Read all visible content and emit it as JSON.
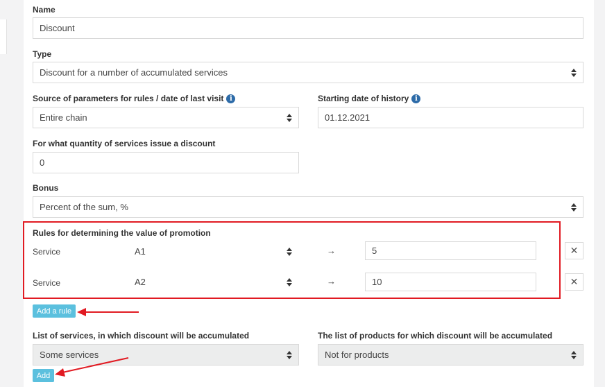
{
  "form": {
    "name": {
      "label": "Name",
      "value": "Discount"
    },
    "type": {
      "label": "Type",
      "value": "Discount for a number of accumulated services"
    },
    "source": {
      "label": "Source of parameters for rules / date of last visit",
      "value": "Entire chain"
    },
    "start_date": {
      "label": "Starting date of history",
      "value": "01.12.2021"
    },
    "quantity": {
      "label": "For what quantity of services issue a discount",
      "value": "0"
    },
    "bonus": {
      "label": "Bonus",
      "value": "Percent of the sum, %"
    },
    "rules": {
      "label": "Rules for determining the value of promotion",
      "items": [
        {
          "kind": "Service",
          "service": "A1",
          "arrow": "→",
          "value": "5",
          "remove": "✕"
        },
        {
          "kind": "Service",
          "service": "A2",
          "arrow": "→",
          "value": "10",
          "remove": "✕"
        }
      ],
      "add_label": "Add a rule"
    },
    "services_list": {
      "label": "List of services, in which discount will be accumulated",
      "value": "Some services",
      "add_label": "Add"
    },
    "products_list": {
      "label": "The list of products for which discount will be accumulated",
      "value": "Not for products"
    }
  },
  "colors": {
    "annotation": "#e11a22",
    "button": "#5bc0de",
    "info": "#2d6ba8"
  }
}
